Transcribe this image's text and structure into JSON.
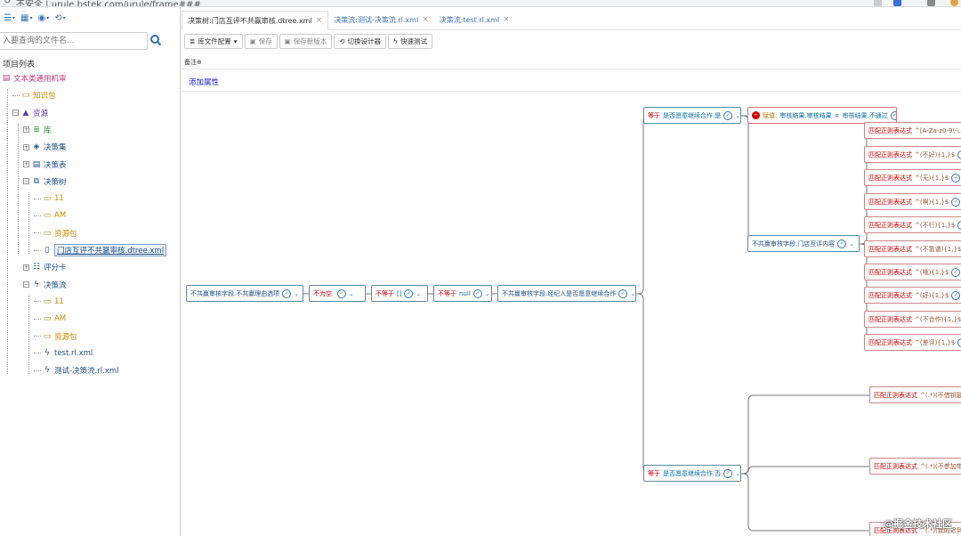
{
  "browser": {
    "url_text": "不安全 | urule.bstek.com/urule/frame###"
  },
  "left_panel": {
    "toolbar": [
      {
        "icon": "list-icon",
        "glyph": "☰"
      },
      {
        "icon": "grid-icon",
        "glyph": "▦"
      },
      {
        "icon": "globe-icon",
        "glyph": "◉"
      },
      {
        "icon": "refresh-icon",
        "glyph": "⟲"
      }
    ],
    "search": {
      "placeholder": "入要查询的文件名..."
    },
    "project_list_label": "项目列表",
    "tree": [
      {
        "label": "文本类通用机审",
        "icon": "project-icon",
        "glyph": "▤",
        "color": "#c0397a",
        "depth": 0,
        "exp": false
      },
      {
        "label": "知识包",
        "icon": "package-icon",
        "glyph": "▭",
        "color": "#c98a00",
        "depth": 1,
        "exp": false
      },
      {
        "label": "资源",
        "icon": "bank-icon",
        "glyph": "▲",
        "color": "#5b3fb0",
        "depth": 1,
        "exp": "−"
      },
      {
        "label": "库",
        "icon": "database-icon",
        "glyph": "≣",
        "color": "#2f8f2f",
        "depth": 2,
        "exp": "+"
      },
      {
        "label": "决策集",
        "icon": "ruleset-icon",
        "glyph": "◈",
        "color": "#1f4f86",
        "depth": 2,
        "exp": "+"
      },
      {
        "label": "决策表",
        "icon": "table-icon",
        "glyph": "▤",
        "color": "#1f4f86",
        "depth": 2,
        "exp": "+"
      },
      {
        "label": "决策树",
        "icon": "tree-icon",
        "glyph": "⧉",
        "color": "#1f4f86",
        "depth": 2,
        "exp": "−"
      },
      {
        "label": "11",
        "icon": "folder-icon",
        "glyph": "▭",
        "color": "#c98a00",
        "depth": 3,
        "exp": false
      },
      {
        "label": "AM",
        "icon": "folder-icon",
        "glyph": "▭",
        "color": "#c98a00",
        "depth": 3,
        "exp": false
      },
      {
        "label": "资源包",
        "icon": "folder-icon",
        "glyph": "▭",
        "color": "#c98a00",
        "depth": 3,
        "exp": false
      },
      {
        "label": "门店互评不共赢审核.dtree.xml",
        "icon": "file-icon",
        "glyph": "▯",
        "color": "#1f4f86",
        "depth": 3,
        "exp": false,
        "selected": true
      },
      {
        "label": "评分卡",
        "icon": "scorecard-icon",
        "glyph": "☷",
        "color": "#1f4f86",
        "depth": 2,
        "exp": "+"
      },
      {
        "label": "决策流",
        "icon": "flow-icon",
        "glyph": "ϟ",
        "color": "#1f4f86",
        "depth": 2,
        "exp": "−"
      },
      {
        "label": "11",
        "icon": "folder-icon",
        "glyph": "▭",
        "color": "#c98a00",
        "depth": 3,
        "exp": false
      },
      {
        "label": "AM",
        "icon": "folder-icon",
        "glyph": "▭",
        "color": "#c98a00",
        "depth": 3,
        "exp": false
      },
      {
        "label": "资源包",
        "icon": "folder-icon",
        "glyph": "▭",
        "color": "#c98a00",
        "depth": 3,
        "exp": false
      },
      {
        "label": "test.rl.xml",
        "icon": "flow-file-icon",
        "glyph": "ϟ",
        "color": "#1f4f86",
        "depth": 3,
        "exp": false
      },
      {
        "label": "测试-决策流.rl.xml",
        "icon": "flow-file-icon",
        "glyph": "ϟ",
        "color": "#1f4f86",
        "depth": 3,
        "exp": false
      }
    ]
  },
  "tabs": [
    {
      "label": "决策树:门店互评不共赢审核.dtree.xml",
      "active": true
    },
    {
      "label": "决策流:测试-决策流.rl.xml",
      "active": false
    },
    {
      "label": "决策流:test.rl.xml",
      "active": false
    }
  ],
  "toolbar": {
    "lib_config": "库文件配置",
    "save": "保存",
    "save_new_version": "保存新版本",
    "switch_designer": "切换设计器",
    "quick_test": "快速测试"
  },
  "note_label": "备注",
  "add_attribute": "添加属性",
  "tree_nodes": {
    "root": {
      "text": "不共赢审核字段.不共赢理由选项"
    },
    "n1": {
      "op": "不为空",
      "val": ""
    },
    "n2": {
      "op": "不等于",
      "val": "[]"
    },
    "n3": {
      "op": "不等于",
      "val": "null"
    },
    "n4": {
      "text": "不共赢审核字段.经纪人是否愿意继续合作"
    },
    "yes": {
      "op": "等于",
      "val": "是否愿意继续合作.是"
    },
    "action": {
      "label": "赋值:",
      "target": "审核结果.审核结果",
      "eq": "=",
      "result": "审核结果.不通过"
    },
    "content": {
      "text": "不共赢审核字段.门店互评内容"
    },
    "no": {
      "op": "等于",
      "val": "是否愿意继续合作.否"
    },
    "regex_upper": [
      {
        "op": "匹配正则表达式",
        "val": "^[A-Za-z0-9\\-\\.\\,\\*"
      },
      {
        "op": "匹配正则表达式",
        "val": "^(不好){1,}$"
      },
      {
        "op": "匹配正则表达式",
        "val": "^(无){1,}$"
      },
      {
        "op": "匹配正则表达式",
        "val": "^(啊){1,}$"
      },
      {
        "op": "匹配正则表达式",
        "val": "^(不行){1,}$"
      },
      {
        "op": "匹配正则表达式",
        "val": "^(不靠谱){1,}$"
      },
      {
        "op": "匹配正则表达式",
        "val": "^(哦){1,}$"
      },
      {
        "op": "匹配正则表达式",
        "val": "^(好){1,}$"
      },
      {
        "op": "匹配正则表达式",
        "val": "^(不合作){1,}$"
      },
      {
        "op": "匹配正则表达式",
        "val": "^(差评){1,}$"
      }
    ],
    "regex_lower": [
      {
        "op": "匹配正则表达式",
        "val": "^(.*)(不借钥匙|"
      },
      {
        "op": "匹配正则表达式",
        "val": "^(.*)(不参加带看"
      },
      {
        "op": "匹配正则表达式",
        "val": "^(.*)(我的迟到|合"
      }
    ]
  },
  "watermark": "@掘金技术社区"
}
